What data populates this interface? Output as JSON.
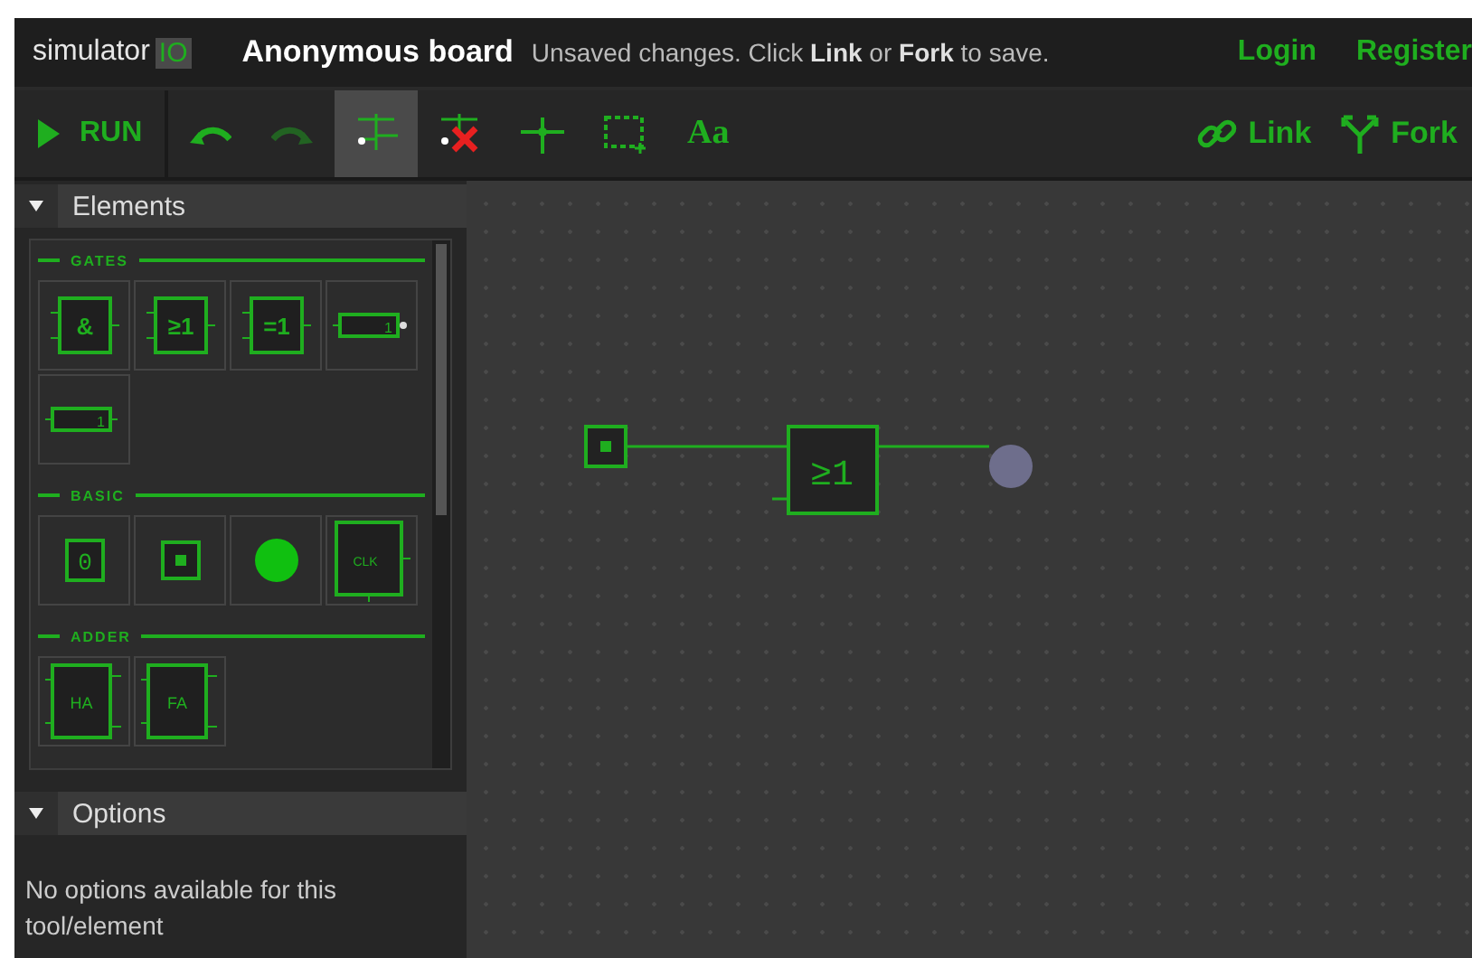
{
  "header": {
    "logo_text": "simulator",
    "logo_badge": "IO",
    "board_title": "Anonymous board",
    "notice": "Unsaved changes. Click **Link** or **Fork** to save.",
    "links": [
      "Login",
      "Register"
    ]
  },
  "toolbar": {
    "run_label": "RUN",
    "tools": [
      {
        "kind": "undo",
        "selected": false,
        "disabled": false
      },
      {
        "kind": "redo",
        "selected": false,
        "disabled": true
      },
      {
        "kind": "wire",
        "selected": true,
        "disabled": false
      },
      {
        "kind": "delete-wire",
        "selected": false,
        "disabled": false
      },
      {
        "kind": "junction",
        "selected": false,
        "disabled": false
      },
      {
        "kind": "select",
        "selected": false,
        "disabled": false
      },
      {
        "kind": "text",
        "selected": false,
        "disabled": false,
        "label": "Aa"
      }
    ],
    "right_actions": [
      {
        "kind": "link",
        "label": "Link"
      },
      {
        "kind": "fork",
        "label": "Fork"
      }
    ]
  },
  "elements_panel": {
    "title": "Elements",
    "expanded": true,
    "groups": [
      {
        "title": "GATES",
        "items": [
          {
            "kind": "gate",
            "label": "&"
          },
          {
            "kind": "gate",
            "label": "≥1"
          },
          {
            "kind": "gate",
            "label": "=1"
          },
          {
            "kind": "not",
            "label": "1"
          },
          {
            "kind": "buffer",
            "label": "1"
          }
        ]
      },
      {
        "title": "BASIC",
        "items": [
          {
            "kind": "constant",
            "label": "0"
          },
          {
            "kind": "button"
          },
          {
            "kind": "led",
            "on": true
          },
          {
            "kind": "clock",
            "label": "CLK"
          }
        ]
      },
      {
        "title": "ADDER",
        "items": [
          {
            "kind": "adder",
            "label": "HA"
          },
          {
            "kind": "adder",
            "label": "FA"
          }
        ]
      }
    ]
  },
  "options_panel": {
    "title": "Options",
    "expanded": true,
    "message": "No options available for this tool/element"
  },
  "board": {
    "components": [
      {
        "kind": "button",
        "on": false
      },
      {
        "kind": "gate",
        "label": "≥1"
      },
      {
        "kind": "led",
        "on": false
      }
    ]
  }
}
